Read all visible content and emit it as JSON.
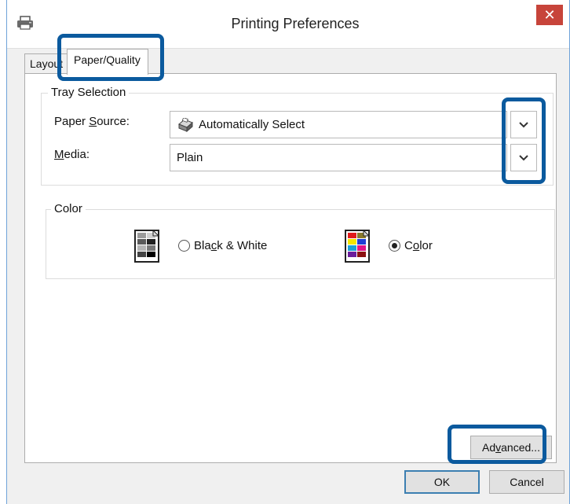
{
  "window": {
    "title": "Printing Preferences",
    "close_glyph": "✕",
    "app_icon": "printer-icon"
  },
  "tabs": [
    {
      "label": "Layout",
      "selected": false
    },
    {
      "label": "Paper/Quality",
      "selected": true
    }
  ],
  "tray_selection": {
    "title": "Tray Selection",
    "paper_source": {
      "label_before": "Paper ",
      "label_mnemonic": "S",
      "label_after": "ource:",
      "value": "Automatically Select",
      "icon": "printer-tray-icon"
    },
    "media": {
      "label_mnemonic": "M",
      "label_after": "edia:",
      "value": "Plain"
    }
  },
  "color": {
    "title": "Color",
    "options": [
      {
        "before": "Bla",
        "mnemonic": "c",
        "after": "k & White",
        "selected": false,
        "icon": "grayscale-swatch-icon"
      },
      {
        "before": "C",
        "mnemonic": "o",
        "after": "lor",
        "selected": true,
        "icon": "color-swatch-icon"
      }
    ]
  },
  "buttons": {
    "advanced": {
      "before": "Ad",
      "mnemonic": "v",
      "after": "anced..."
    },
    "ok": "OK",
    "cancel": "Cancel"
  },
  "colors": {
    "highlight": "#0b5a9e",
    "close_button": "#c7443a",
    "window_border": "#6fa3d9"
  }
}
